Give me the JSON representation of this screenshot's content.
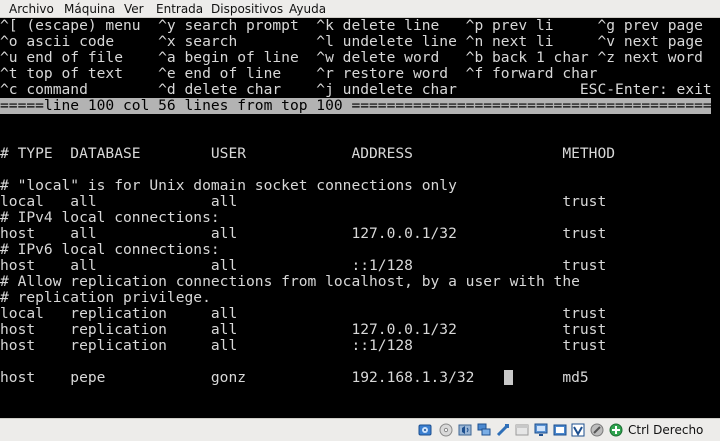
{
  "menubar": {
    "items": [
      "Archivo",
      "Máquina",
      "Ver",
      "Entrada",
      "Dispositivos",
      "Ayuda"
    ]
  },
  "editor": {
    "help_lines": [
      "^[ (escape) menu  ^y search prompt  ^k delete line   ^p prev li     ^g prev page",
      "^o ascii code     ^x search         ^l undelete line ^n next li     ^v next page",
      "^u end of file    ^a begin of line  ^w delete word   ^b back 1 char ^z next word",
      "^t top of text    ^e end of line    ^r restore word  ^f forward char",
      "^c command        ^d delete char    ^j undelete char              ESC-Enter: exit"
    ],
    "status_line": "=====line 100 col 56 lines from top 100 ==========================================",
    "content_lines": [
      "",
      "# TYPE  DATABASE        USER            ADDRESS                 METHOD",
      "",
      "# \"local\" is for Unix domain socket connections only",
      "local   all             all                                     trust",
      "# IPv4 local connections:",
      "host    all             all             127.0.0.1/32            trust",
      "# IPv6 local connections:",
      "host    all             all             ::1/128                 trust",
      "# Allow replication connections from localhost, by a user with the",
      "# replication privilege.",
      "local   replication     all                                     trust",
      "host    replication     all             127.0.0.1/32            trust",
      "host    replication     all             ::1/128                 trust",
      "",
      "host    pepe            gonz            192.168.1.3/32          md5"
    ]
  },
  "vbox_status": {
    "icons": [
      "hard-disk-icon",
      "optical-drive-icon",
      "audio-icon",
      "network-icon",
      "usb-icon",
      "shared-folders-icon",
      "display-icon",
      "video-capture-icon",
      "recording-icon",
      "virtualization-icon",
      "mouse-integration-icon",
      "keyboard-capture-icon"
    ],
    "host_key_label": "Ctrl Derecho"
  },
  "colors": {
    "terminal_bg": "#000000",
    "terminal_fg": "#d8d8d8",
    "status_bg": "#b3b3b3",
    "chrome_bg": "#edecea"
  }
}
